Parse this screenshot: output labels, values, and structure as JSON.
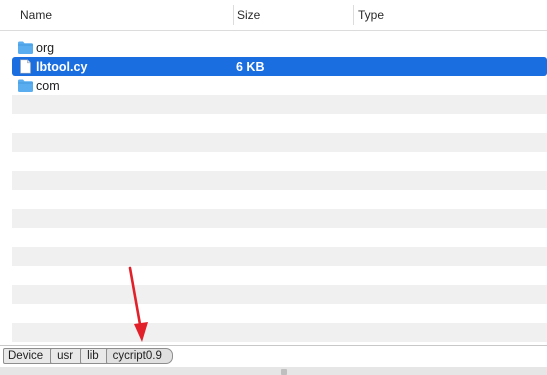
{
  "columns": {
    "name": "Name",
    "size": "Size",
    "type": "Type"
  },
  "files": [
    {
      "name": "org",
      "size": "",
      "icon": "folder-icon",
      "selected": false
    },
    {
      "name": "lbtool.cy",
      "size": "6 KB",
      "icon": "file-icon",
      "selected": true
    },
    {
      "name": "com",
      "size": "",
      "icon": "folder-icon",
      "selected": false
    }
  ],
  "breadcrumb": [
    "Device",
    "usr",
    "lib",
    "cycript0.9"
  ],
  "colors": {
    "selection": "#1a6ee0",
    "folder": "#5aaef0",
    "annotation_arrow": "#e2202a",
    "stripe": "#f0f0f0"
  }
}
